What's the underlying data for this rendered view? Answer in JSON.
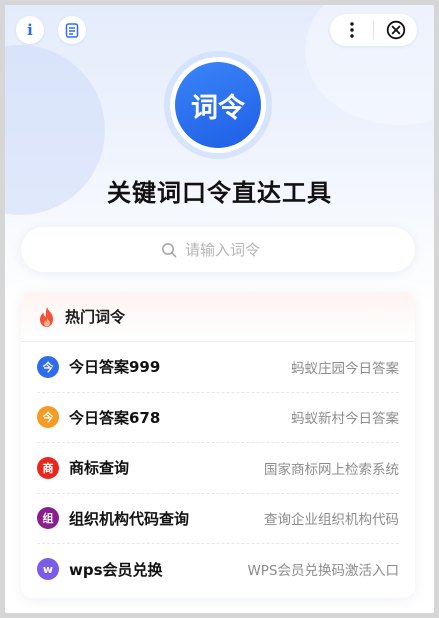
{
  "header": {
    "info_icon_glyph": "i",
    "logo_text": "词令",
    "title": "关键词口令直达工具"
  },
  "search": {
    "placeholder": "请输入词令",
    "icon": "search-icon"
  },
  "hot": {
    "title": "热门词令",
    "icon": "fire-icon",
    "items": [
      {
        "badge": "今",
        "badge_color": "#2f6de8",
        "title": "今日答案999",
        "desc": "蚂蚁庄园今日答案"
      },
      {
        "badge": "今",
        "badge_color": "#f59a23",
        "title": "今日答案678",
        "desc": "蚂蚁新村今日答案"
      },
      {
        "badge": "商",
        "badge_color": "#e8261c",
        "title": "商标查询",
        "desc": "国家商标网上检索系统"
      },
      {
        "badge": "组",
        "badge_color": "#8b1e8f",
        "title": "组织机构代码查询",
        "desc": "查询企业组织机构代码"
      },
      {
        "badge": "w",
        "badge_color": "#7b5ce8",
        "title": "wps会员兑换",
        "desc": "WPS会员兑换码激活入口"
      }
    ]
  },
  "colors": {
    "accent": "#2f6de8",
    "background": "#d6d6d6",
    "card": "#ffffff"
  }
}
